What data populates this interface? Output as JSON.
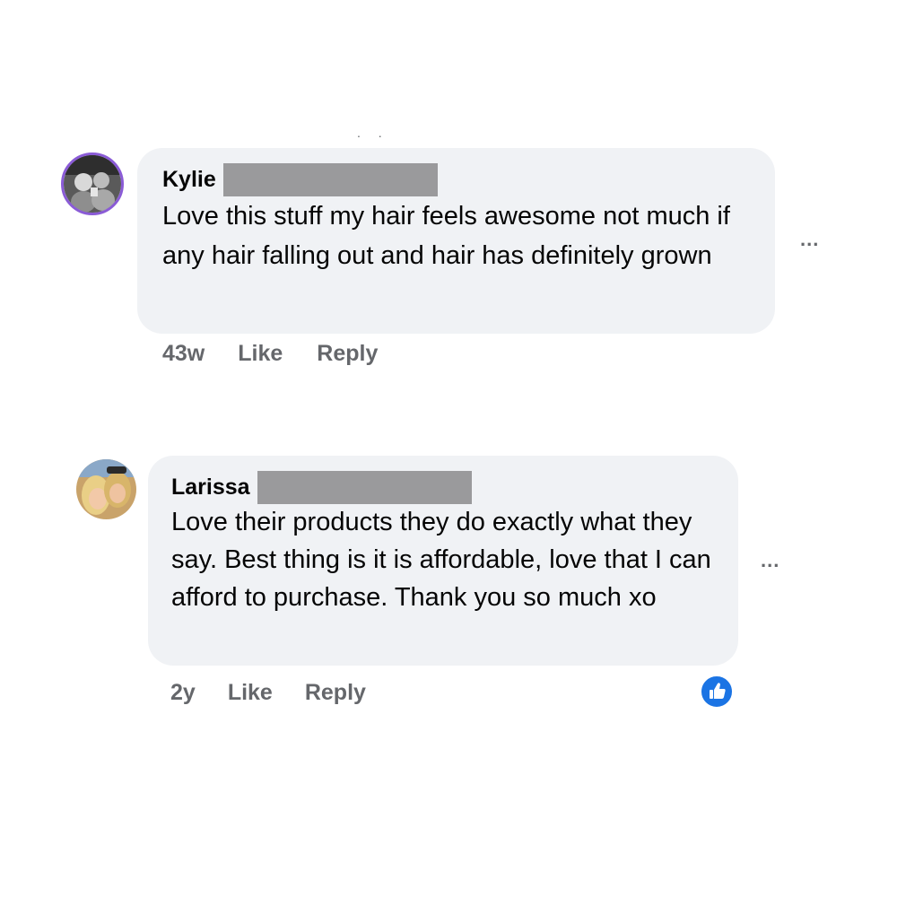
{
  "comments": [
    {
      "author": "Kylie",
      "text": "Love this stuff my hair feels awesome not much if any hair falling out and hair has definitely grown",
      "time": "43w",
      "like_label": "Like",
      "reply_label": "Reply",
      "more_label": "...",
      "reactions": 0
    },
    {
      "author": "Larissa",
      "text": "Love their products they do exactly what they say. Best thing is it is affordable, love that I can afford to purchase. Thank you so much xo",
      "time": "2y",
      "like_label": "Like",
      "reply_label": "Reply",
      "more_label": "...",
      "reactions": 1
    }
  ],
  "colors": {
    "bubble": "#f0f2f5",
    "meta_text": "#65676b",
    "like_blue": "#1b74e4",
    "redaction": "#9a9a9c"
  },
  "icons": [
    "like-reaction-icon",
    "more-options-icon"
  ]
}
